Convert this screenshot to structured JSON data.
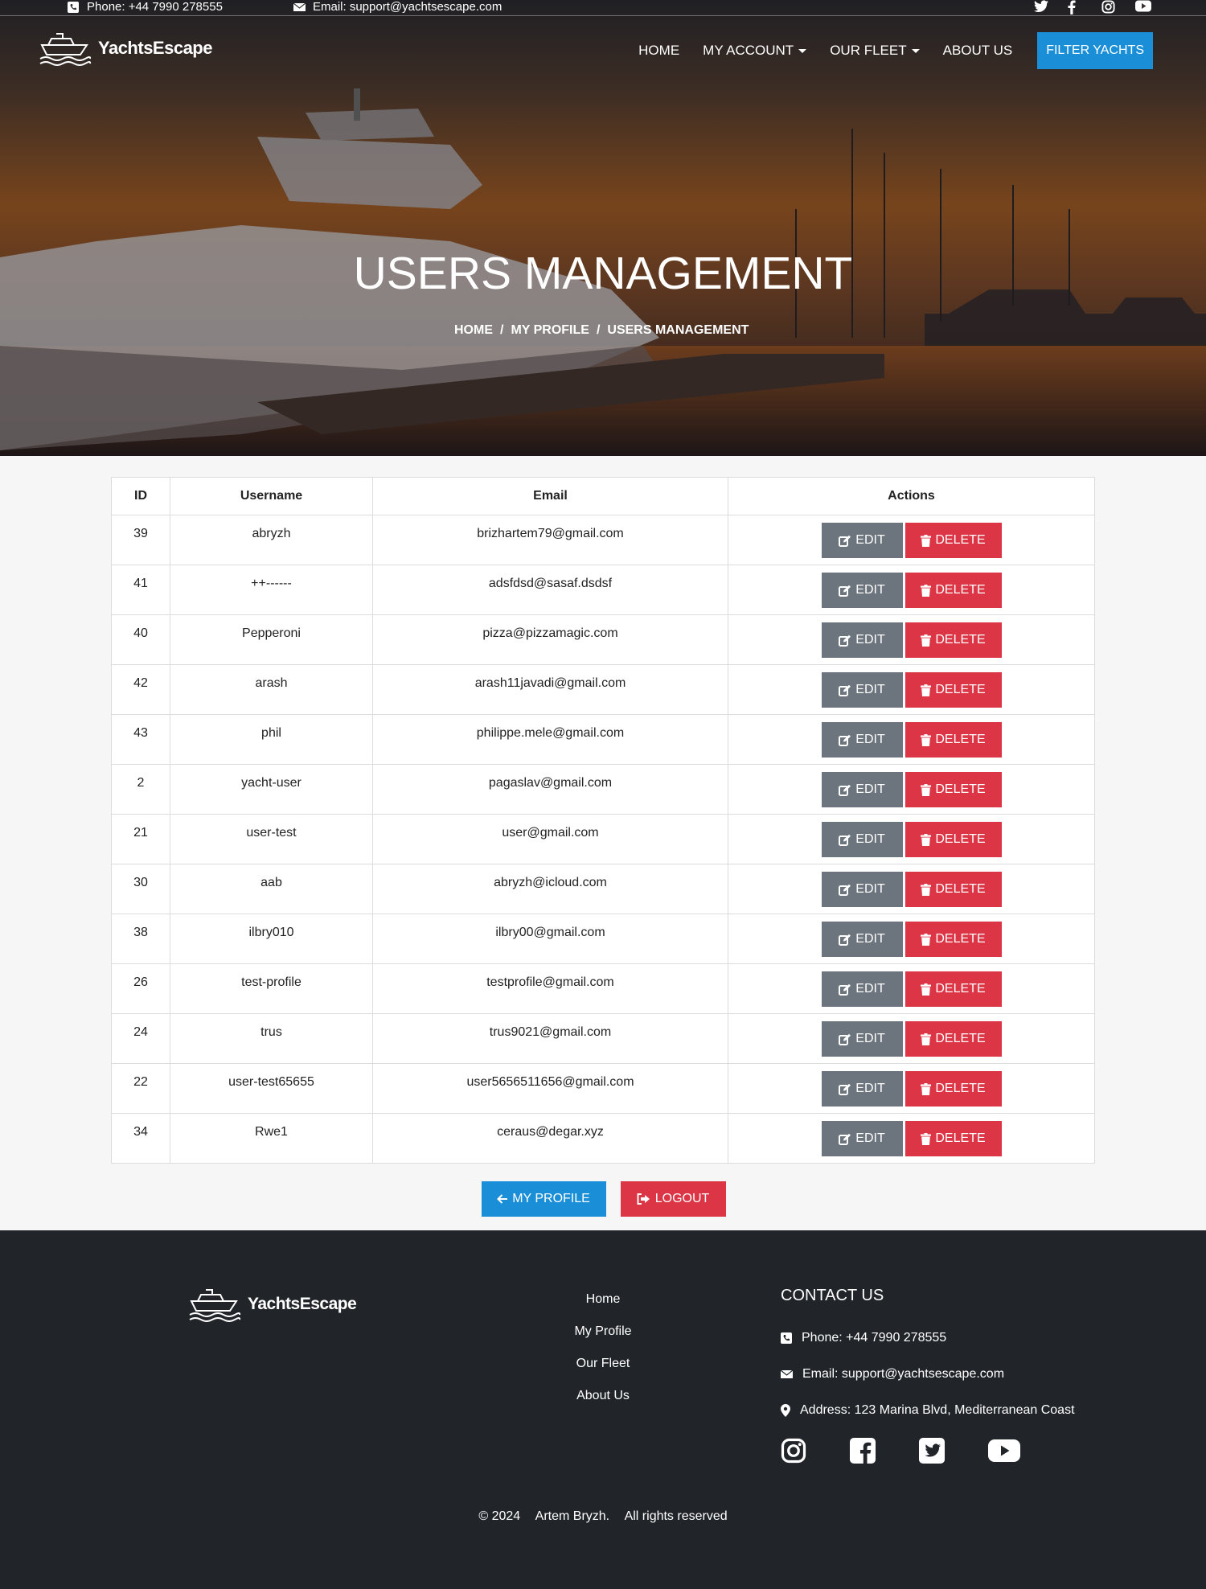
{
  "topbar": {
    "phone": "Phone: +44 7990 278555",
    "email": "Email: support@yachtsescape.com",
    "social_icons": [
      "twitter-icon",
      "facebook-icon",
      "instagram-icon",
      "youtube-icon"
    ]
  },
  "brand": {
    "name": "YachtsEscape"
  },
  "nav": {
    "home": "HOME",
    "my_account": "MY ACCOUNT",
    "our_fleet": "OUR FLEET",
    "about_us": "ABOUT US",
    "filter_yachts": "FILTER YACHTS"
  },
  "hero": {
    "title": "USERS MANAGEMENT",
    "breadcrumb": [
      "HOME",
      "MY PROFILE",
      "USERS MANAGEMENT"
    ]
  },
  "table": {
    "headers": [
      "ID",
      "Username",
      "Email",
      "Actions"
    ],
    "edit_label": "EDIT",
    "delete_label": "DELETE",
    "rows": [
      {
        "id": "39",
        "username": "abryzh",
        "email": "brizhartem79@gmail.com"
      },
      {
        "id": "41",
        "username": "++------",
        "email": "adsfdsd@sasaf.dsdsf"
      },
      {
        "id": "40",
        "username": "Pepperoni",
        "email": "pizza@pizzamagic.com"
      },
      {
        "id": "42",
        "username": "arash",
        "email": "arash11javadi@gmail.com"
      },
      {
        "id": "43",
        "username": "phil",
        "email": "philippe.mele@gmail.com"
      },
      {
        "id": "2",
        "username": "yacht-user",
        "email": "pagaslav@gmail.com"
      },
      {
        "id": "21",
        "username": "user-test",
        "email": "user@gmail.com"
      },
      {
        "id": "30",
        "username": "aab",
        "email": "abryzh@icloud.com"
      },
      {
        "id": "38",
        "username": "ilbry010",
        "email": "ilbry00@gmail.com"
      },
      {
        "id": "26",
        "username": "test-profile",
        "email": "testprofile@gmail.com"
      },
      {
        "id": "24",
        "username": "trus",
        "email": "trus9021@gmail.com"
      },
      {
        "id": "22",
        "username": "user-test65655",
        "email": "user5656511656@gmail.com"
      },
      {
        "id": "34",
        "username": "Rwe1",
        "email": "ceraus@degar.xyz"
      }
    ]
  },
  "actions": {
    "my_profile": "MY PROFILE",
    "logout": "LOGOUT"
  },
  "footer": {
    "links": [
      "Home",
      "My Profile",
      "Our Fleet",
      "About Us"
    ],
    "contact_heading": "CONTACT US",
    "phone": "Phone: +44 7990 278555",
    "email": "Email: support@yachtsescape.com",
    "address": "Address: 123 Marina Blvd, Mediterranean Coast",
    "social_icons": [
      "instagram-icon",
      "facebook-icon",
      "twitter-icon",
      "youtube-icon"
    ],
    "copyright": [
      "© 2024",
      "Artem Bryzh.",
      "All rights reserved"
    ]
  },
  "colors": {
    "primary": "#1a8fd8",
    "danger": "#dc3545",
    "secondary": "#6c757d",
    "footer_bg": "#212529"
  }
}
